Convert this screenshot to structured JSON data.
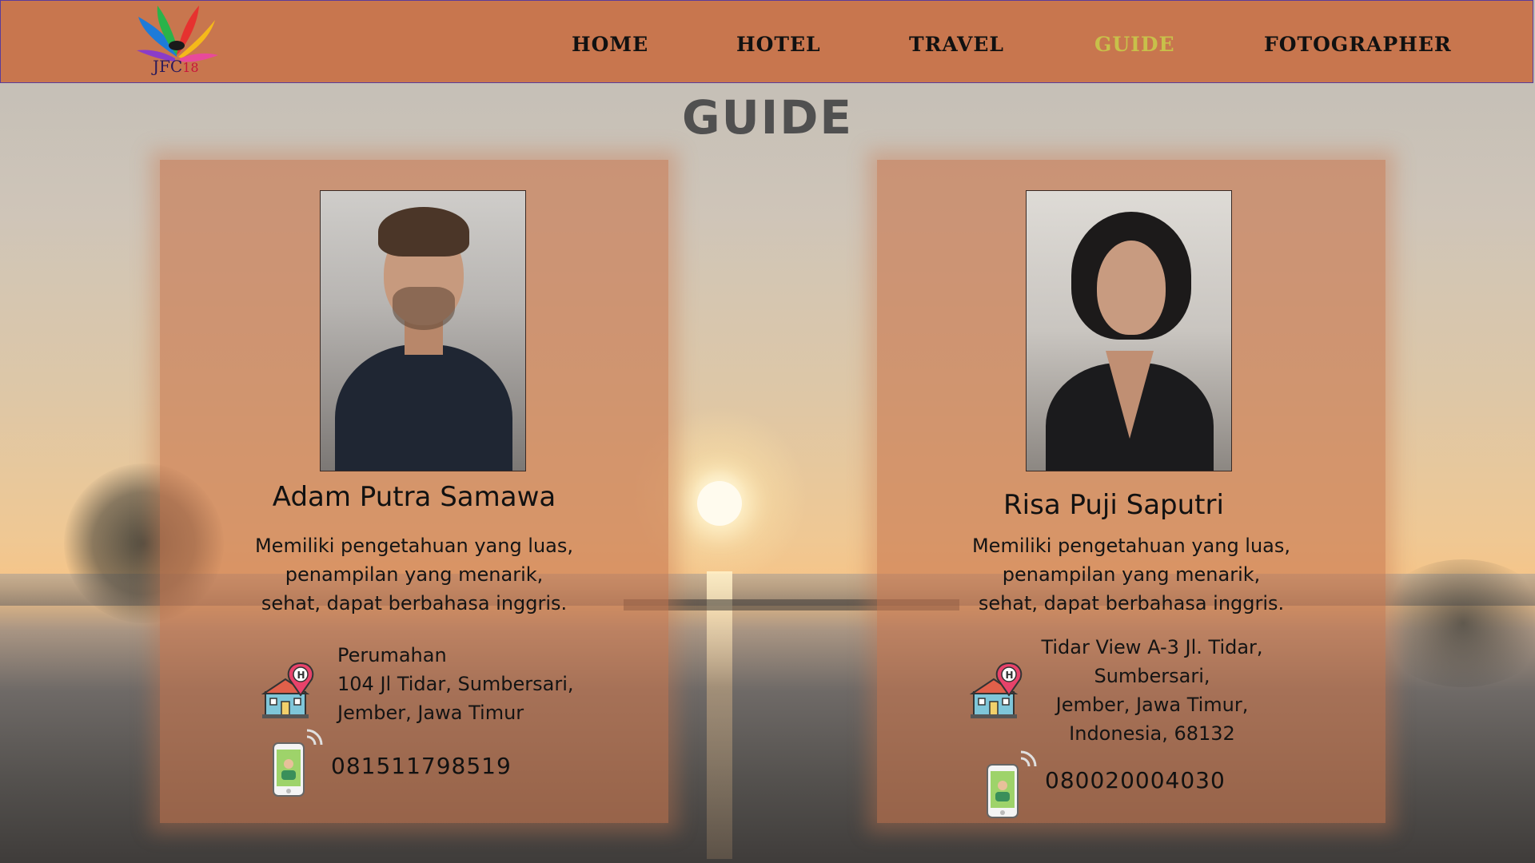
{
  "brand": {
    "logo_text": "JFC",
    "logo_number": "18"
  },
  "nav": {
    "items": [
      {
        "label": "HOME",
        "active": false
      },
      {
        "label": "HOTEL",
        "active": false
      },
      {
        "label": "TRAVEL",
        "active": false
      },
      {
        "label": "GUIDE",
        "active": true
      },
      {
        "label": "FOTOGRAPHER",
        "active": false
      }
    ],
    "active_color": "#c8c04a"
  },
  "page": {
    "title": "GUIDE"
  },
  "colors": {
    "nav_background": "#c8764e",
    "card_background": "#c8764e"
  },
  "guides": [
    {
      "name": "Adam Putra Samawa",
      "photo_icon": "man-portrait-photo",
      "description_lines": [
        "Memiliki pengetahuan yang luas,",
        "penampilan yang menarik,",
        "sehat, dapat berbahasa inggris."
      ],
      "address_lines": [
        "Perumahan",
        "104 Jl Tidar, Sumbersari,",
        "Jember, Jawa Timur"
      ],
      "phone": "081511798519"
    },
    {
      "name": "Risa Puji Saputri",
      "photo_icon": "woman-portrait-photo",
      "description_lines": [
        "Memiliki pengetahuan yang luas,",
        "penampilan yang menarik,",
        "sehat, dapat berbahasa inggris."
      ],
      "address_lines": [
        "Tidar View A-3 Jl. Tidar,",
        "Sumbersari,",
        "Jember, Jawa Timur,",
        "Indonesia, 68132"
      ],
      "phone": "080020004030"
    }
  ]
}
